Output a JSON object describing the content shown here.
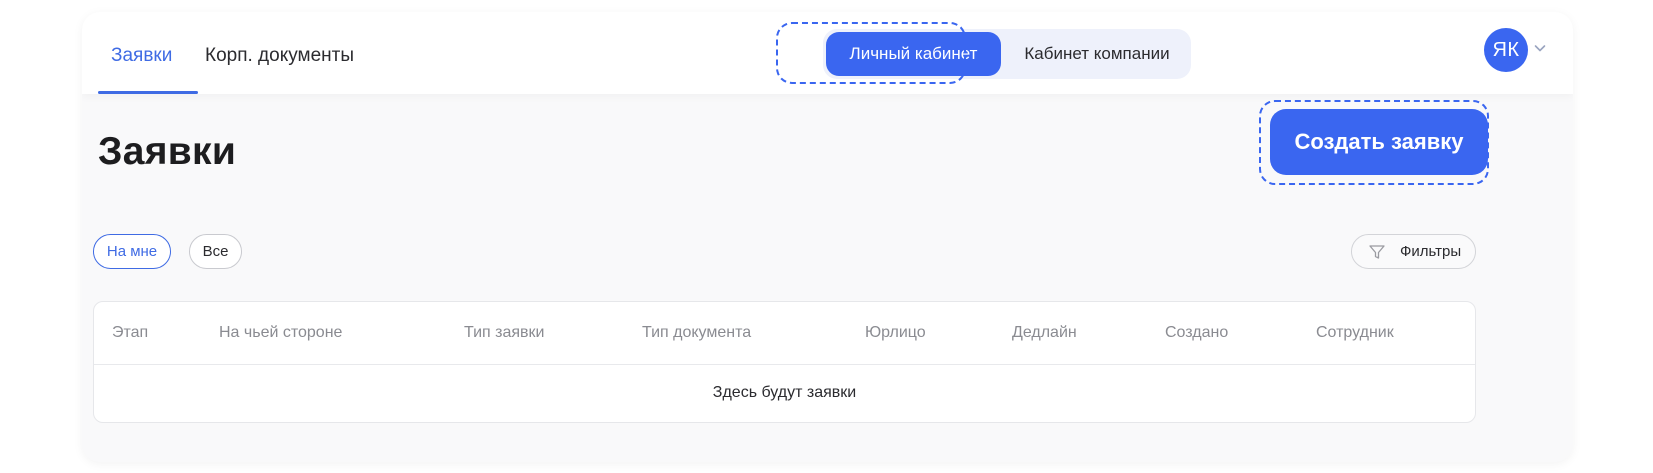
{
  "nav": {
    "tabs": [
      {
        "label": "Заявки",
        "active": true
      },
      {
        "label": "Корп. документы",
        "active": false
      }
    ]
  },
  "cabinet_switcher": {
    "personal": "Личный кабинет",
    "company": "Кабинет компании"
  },
  "user": {
    "initials": "ЯК",
    "menu_icon": "chevron-down-icon"
  },
  "page": {
    "title": "Заявки",
    "create_button": "Создать заявку"
  },
  "filters": {
    "scope": [
      {
        "label": "На мне",
        "selected": true
      },
      {
        "label": "Все",
        "selected": false
      }
    ],
    "filters_button": "Фильтры",
    "filters_icon": "funnel-icon"
  },
  "table": {
    "columns": [
      "Этап",
      "На чьей стороне",
      "Тип заявки",
      "Тип документа",
      "Юрлицо",
      "Дедлайн",
      "Создано",
      "Сотрудник"
    ],
    "empty_text": "Здесь будут заявки"
  },
  "colors": {
    "accent": "#3a66f0",
    "link": "#3f6be4"
  }
}
